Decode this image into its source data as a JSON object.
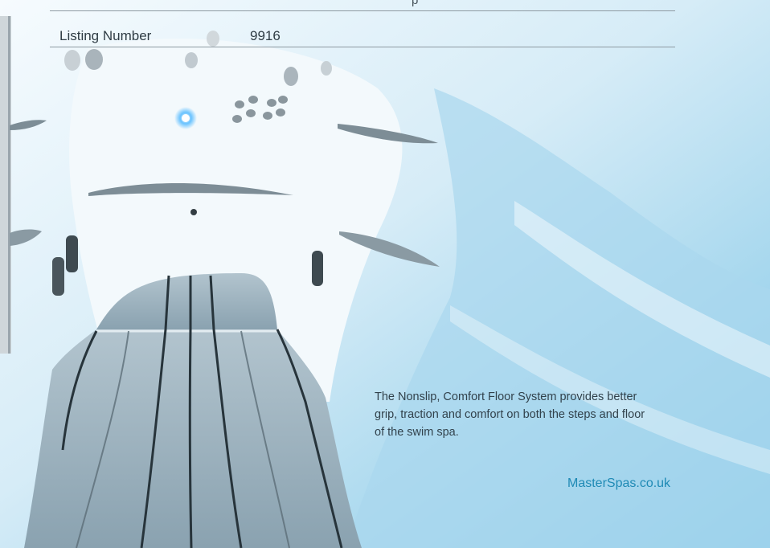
{
  "spec_table": {
    "top_row_clipped_text": "p",
    "listing_label": "Listing Number",
    "listing_value": "9916"
  },
  "caption": "The Nonslip, Comfort Floor System provides better grip, traction and comfort on both the steps and floor of the swim spa.",
  "site_link": "MasterSpas.co.uk"
}
